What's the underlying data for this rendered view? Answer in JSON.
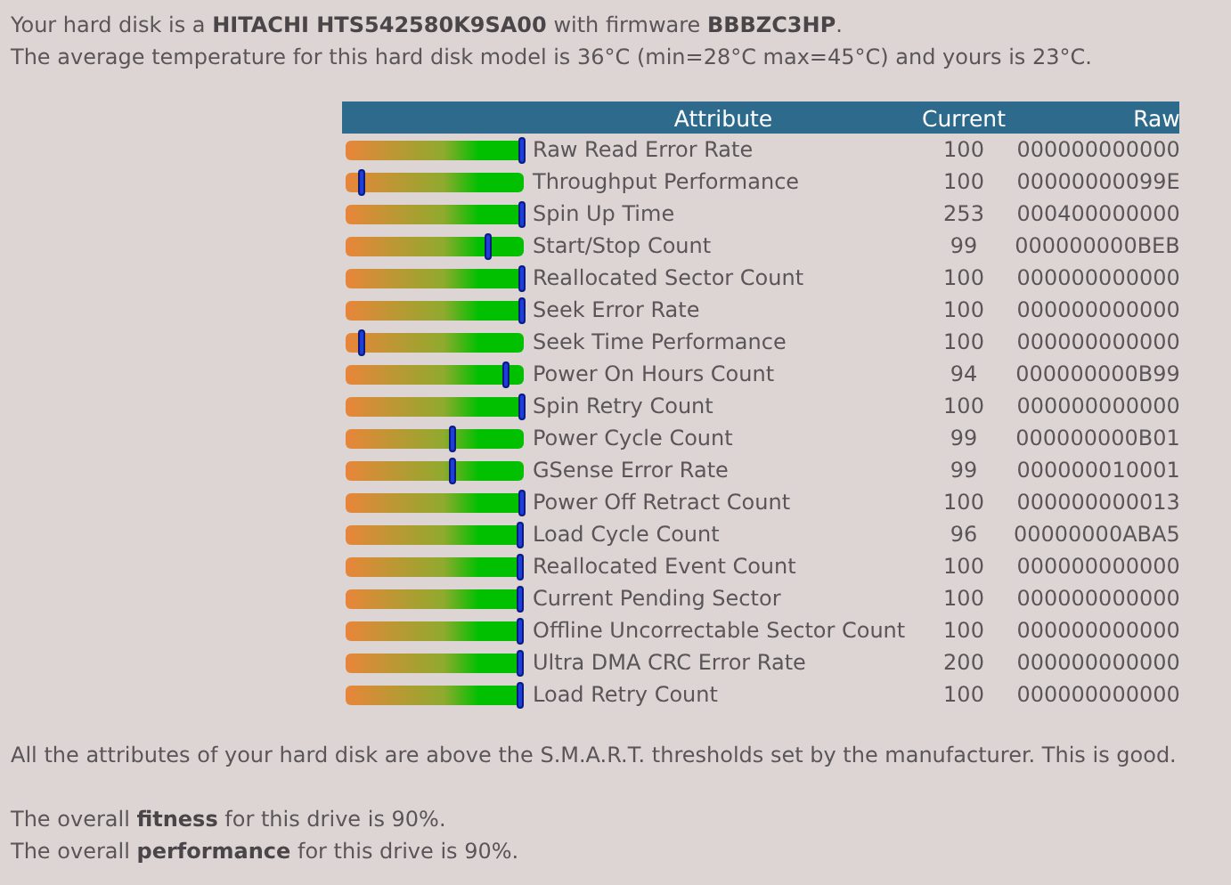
{
  "intro": [
    "Your hard disk is a **HITACHI HTS542580K9SA00** with firmware **BBBZC3HP**.",
    "The average temperature for this hard disk model is 36°C (min=28°C max=45°C) and yours is 23°C."
  ],
  "table": {
    "columns": [
      "Attribute",
      "Current",
      "Raw"
    ],
    "rows": [
      {
        "level": 1.0,
        "attribute": "Raw Read Error Rate",
        "current": "100",
        "raw": "000000000000"
      },
      {
        "level": 0.1,
        "attribute": "Throughput Performance",
        "current": "100",
        "raw": "00000000099E"
      },
      {
        "level": 1.0,
        "attribute": "Spin Up Time",
        "current": "253",
        "raw": "000400000000"
      },
      {
        "level": 0.81,
        "attribute": "Start/Stop Count",
        "current": "99",
        "raw": "000000000BEB"
      },
      {
        "level": 1.0,
        "attribute": "Reallocated Sector Count",
        "current": "100",
        "raw": "000000000000"
      },
      {
        "level": 1.0,
        "attribute": "Seek Error Rate",
        "current": "100",
        "raw": "000000000000"
      },
      {
        "level": 0.1,
        "attribute": "Seek Time Performance",
        "current": "100",
        "raw": "000000000000"
      },
      {
        "level": 0.91,
        "attribute": "Power On Hours Count",
        "current": "94",
        "raw": "000000000B99"
      },
      {
        "level": 1.0,
        "attribute": "Spin Retry Count",
        "current": "100",
        "raw": "000000000000"
      },
      {
        "level": 0.61,
        "attribute": "Power Cycle Count",
        "current": "99",
        "raw": "000000000B01"
      },
      {
        "level": 0.61,
        "attribute": "GSense Error Rate",
        "current": "99",
        "raw": "000000010001"
      },
      {
        "level": 1.0,
        "attribute": "Power Off Retract Count",
        "current": "100",
        "raw": "000000000013"
      },
      {
        "level": 0.99,
        "attribute": "Load Cycle Count",
        "current": "96",
        "raw": "00000000ABA5"
      },
      {
        "level": 0.99,
        "attribute": "Reallocated Event Count",
        "current": "100",
        "raw": "000000000000"
      },
      {
        "level": 0.99,
        "attribute": "Current Pending Sector",
        "current": "100",
        "raw": "000000000000"
      },
      {
        "level": 0.99,
        "attribute": "Offline Uncorrectable Sector Count",
        "current": "100",
        "raw": "000000000000"
      },
      {
        "level": 0.99,
        "attribute": "Ultra DMA CRC Error Rate",
        "current": "200",
        "raw": "000000000000"
      },
      {
        "level": 0.99,
        "attribute": "Load Retry Count",
        "current": "100",
        "raw": "000000000000"
      }
    ]
  },
  "summary": "All the attributes of your hard disk are above the S.M.A.R.T. thresholds set by the manufacturer. This is good.",
  "overall": [
    "The overall **fitness** for this drive is 90%.",
    "The overall **performance** for this drive is 90%."
  ]
}
